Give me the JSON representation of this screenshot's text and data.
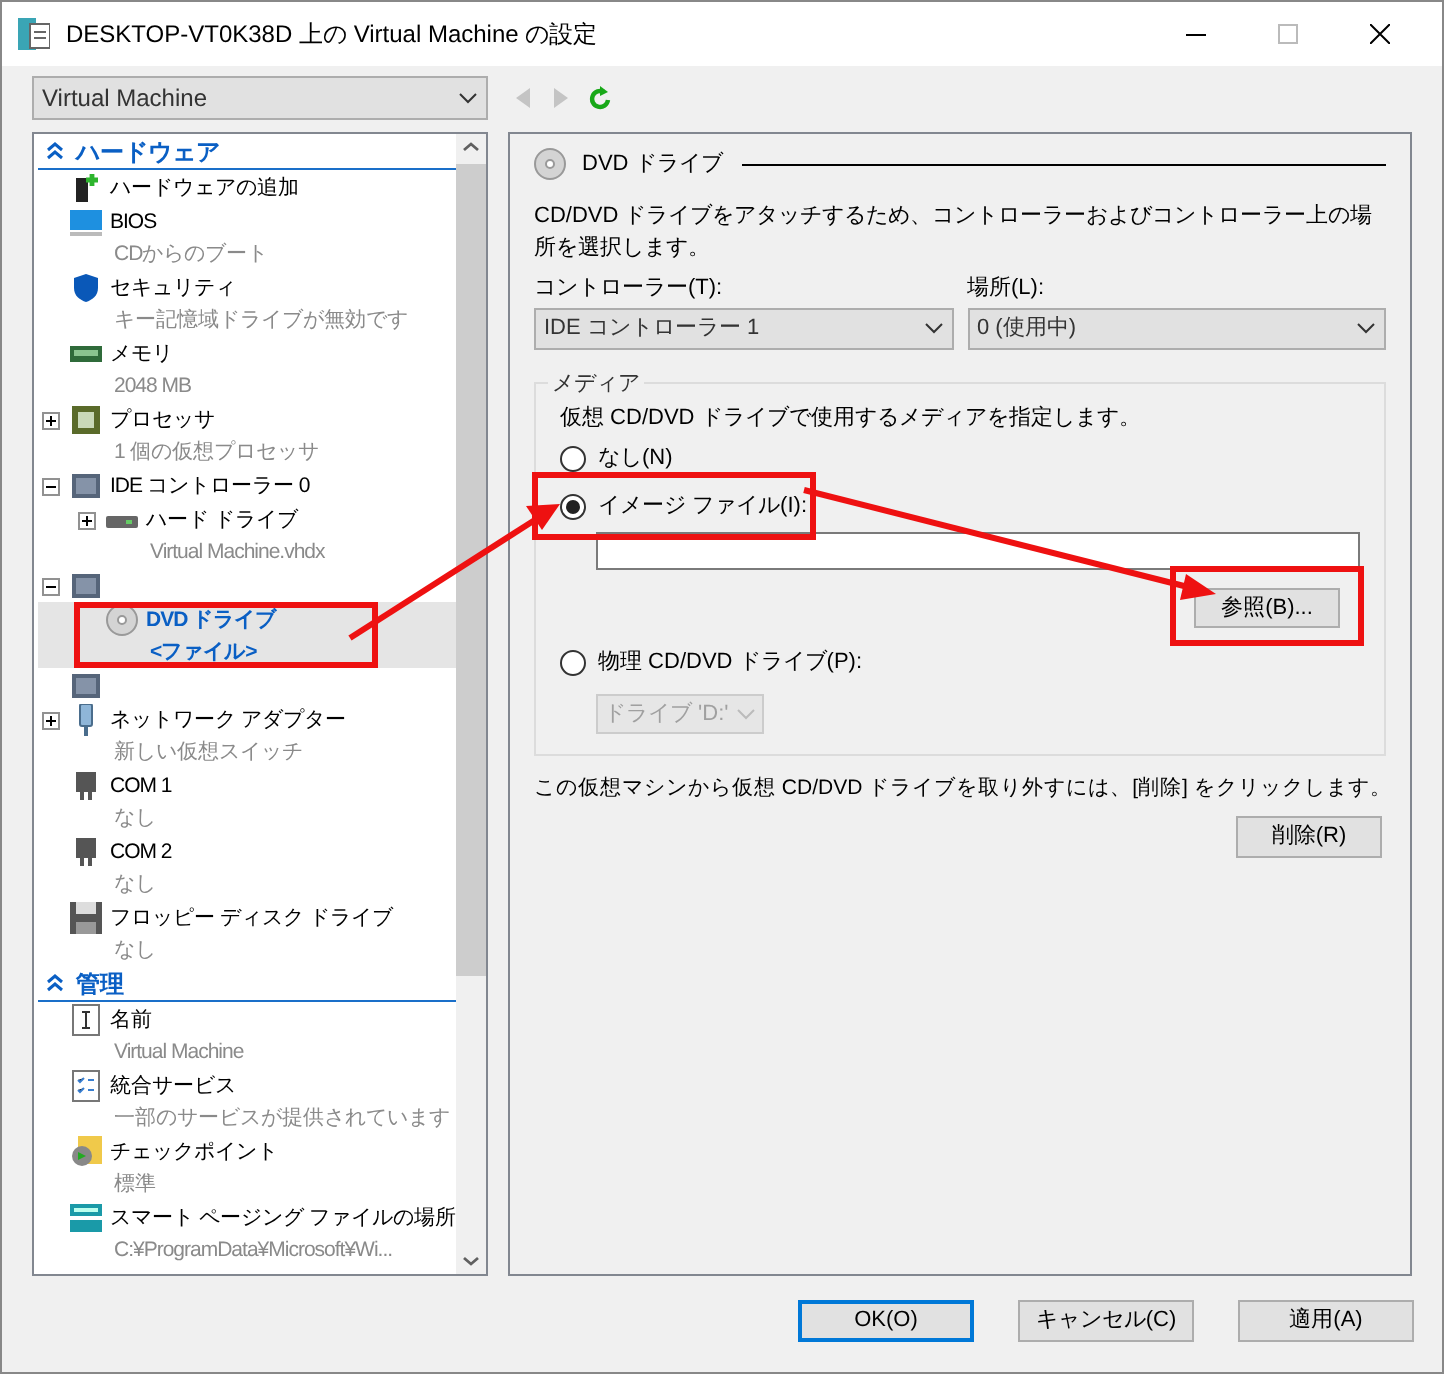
{
  "window": {
    "title": "DESKTOP-VT0K38D 上の Virtual Machine の設定"
  },
  "vm_select": {
    "value": "Virtual Machine"
  },
  "nav": {
    "back_disabled": true,
    "forward_disabled": true
  },
  "tree": [
    {
      "heading": "ハードウェア",
      "items": [
        {
          "label": "ハードウェアの追加",
          "selected": false
        },
        {
          "label": "BIOS",
          "detail": "CDからのブート",
          "selected": false
        },
        {
          "label": "セキュリティ",
          "detail": "キー記憶域ドライブが無効です",
          "selected": false
        },
        {
          "label": "メモリ",
          "detail": "2048 MB",
          "selected": false
        },
        {
          "label": "プロセッサ",
          "detail": "1 個の仮想プロセッサ",
          "expanded": false,
          "selected": false
        },
        {
          "label": "IDE コントローラー 0",
          "expanded": true,
          "selected": false,
          "children": [
            {
              "label": "ハード ドライブ",
              "detail": "Virtual Machine.vhdx",
              "expanded": false,
              "selected": false
            }
          ]
        },
        {
          "expanded": true,
          "selected": false,
          "children": [
            {
              "label": "DVD ドライブ",
              "detail": "<ファイル>",
              "selected": true
            }
          ]
        },
        {
          "selected": false
        },
        {
          "label": "ネットワーク アダプター",
          "detail": "新しい仮想スイッチ",
          "expanded": false,
          "selected": false
        },
        {
          "label": "COM 1",
          "detail": "なし",
          "selected": false
        },
        {
          "label": "COM 2",
          "detail": "なし",
          "selected": false
        },
        {
          "label": "フロッピー ディスク ドライブ",
          "detail": "なし",
          "selected": false
        }
      ]
    },
    {
      "heading": "管理",
      "items": [
        {
          "label": "名前",
          "detail": "Virtual Machine",
          "selected": false
        },
        {
          "label": "統合サービス",
          "detail": "一部のサービスが提供されています",
          "selected": false
        },
        {
          "label": "チェックポイント",
          "detail": "標準",
          "selected": false
        },
        {
          "label": "スマート ページング ファイルの場所",
          "detail": "C:¥ProgramData¥Microsoft¥Wi...",
          "selected": false
        }
      ]
    }
  ],
  "panel": {
    "title": "DVD ドライブ",
    "description": "CD/DVD ドライブをアタッチするため、コントローラーおよびコントローラー上の場所を選択します。",
    "controller": {
      "label": "コントローラー(T):",
      "value": "IDE コントローラー 1"
    },
    "location": {
      "label": "場所(L):",
      "value": "0 (使用中)"
    },
    "media": {
      "legend": "メディア",
      "description": "仮想 CD/DVD ドライブで使用するメディアを指定します。",
      "options": [
        {
          "kind": "plain",
          "label": "なし(N)",
          "selected": false
        },
        {
          "kind": "file",
          "label": "イメージ ファイル(I):",
          "selected": true,
          "browse": "参照(B)..."
        },
        {
          "kind": "physical",
          "label": "物理 CD/DVD ドライブ(P):",
          "selected": false,
          "drive": "ドライブ 'D:'",
          "drive_disabled": true
        }
      ]
    },
    "remove_note": "この仮想マシンから仮想 CD/DVD ドライブを取り外すには、[削除] をクリックします。",
    "remove_button": "削除(R)"
  },
  "buttons": [
    {
      "label": "OK(O)",
      "default": true
    },
    {
      "label": "キャンセル(C)",
      "default": false
    },
    {
      "label": "適用(A)",
      "default": false
    }
  ]
}
